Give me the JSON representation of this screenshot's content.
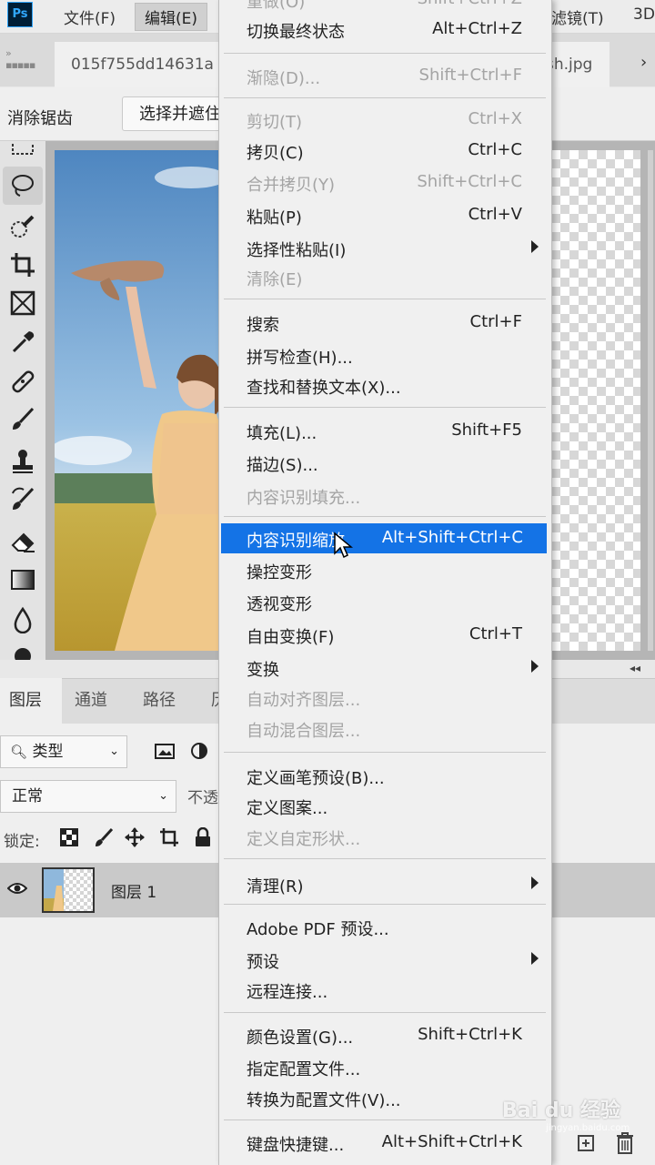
{
  "app": {
    "logo": "Ps"
  },
  "menubar": {
    "items": [
      {
        "label": "文件(F)"
      },
      {
        "label": "编辑(E)"
      },
      {
        "label": "滤镜(T)"
      },
      {
        "label": "3D"
      }
    ]
  },
  "tabs": [
    {
      "label": "015f755dd14631a"
    },
    {
      "label": "sh.jpg"
    }
  ],
  "options": {
    "antialias": "消除锯齿",
    "select_mask": "选择并遮住"
  },
  "edit_menu": {
    "items": [
      {
        "label": "重做(O)",
        "shortcut": "Shift+Ctrl+Z",
        "disabled": true
      },
      {
        "label": "切换最终状态",
        "shortcut": "Alt+Ctrl+Z"
      },
      {
        "label": "渐隐(D)...",
        "shortcut": "Shift+Ctrl+F",
        "disabled": true
      },
      {
        "label": "剪切(T)",
        "shortcut": "Ctrl+X",
        "disabled": true
      },
      {
        "label": "拷贝(C)",
        "shortcut": "Ctrl+C"
      },
      {
        "label": "合并拷贝(Y)",
        "shortcut": "Shift+Ctrl+C",
        "disabled": true
      },
      {
        "label": "粘贴(P)",
        "shortcut": "Ctrl+V"
      },
      {
        "label": "选择性粘贴(I)",
        "shortcut": "",
        "submenu": true
      },
      {
        "label": "清除(E)",
        "shortcut": "",
        "disabled": true
      },
      {
        "label": "搜索",
        "shortcut": "Ctrl+F"
      },
      {
        "label": "拼写检查(H)...",
        "shortcut": ""
      },
      {
        "label": "查找和替换文本(X)...",
        "shortcut": ""
      },
      {
        "label": "填充(L)...",
        "shortcut": "Shift+F5"
      },
      {
        "label": "描边(S)...",
        "shortcut": ""
      },
      {
        "label": "内容识别填充...",
        "shortcut": "",
        "disabled": true
      },
      {
        "label": "内容识别缩放",
        "shortcut": "Alt+Shift+Ctrl+C",
        "highlighted": true
      },
      {
        "label": "操控变形",
        "shortcut": ""
      },
      {
        "label": "透视变形",
        "shortcut": ""
      },
      {
        "label": "自由变换(F)",
        "shortcut": "Ctrl+T"
      },
      {
        "label": "变换",
        "shortcut": "",
        "submenu": true
      },
      {
        "label": "自动对齐图层...",
        "shortcut": "",
        "disabled": true
      },
      {
        "label": "自动混合图层...",
        "shortcut": "",
        "disabled": true
      },
      {
        "label": "定义画笔预设(B)...",
        "shortcut": ""
      },
      {
        "label": "定义图案...",
        "shortcut": ""
      },
      {
        "label": "定义自定形状...",
        "shortcut": "",
        "disabled": true
      },
      {
        "label": "清理(R)",
        "shortcut": "",
        "submenu": true
      },
      {
        "label": "Adobe PDF 预设...",
        "shortcut": ""
      },
      {
        "label": "预设",
        "shortcut": "",
        "submenu": true
      },
      {
        "label": "远程连接...",
        "shortcut": ""
      },
      {
        "label": "颜色设置(G)...",
        "shortcut": "Shift+Ctrl+K"
      },
      {
        "label": "指定配置文件...",
        "shortcut": ""
      },
      {
        "label": "转换为配置文件(V)...",
        "shortcut": ""
      },
      {
        "label": "键盘快捷键...",
        "shortcut": "Alt+Shift+Ctrl+K"
      }
    ]
  },
  "layers_panel": {
    "tabs": [
      "图层",
      "通道",
      "路径",
      "历"
    ],
    "filter": "类型",
    "blend_mode": "正常",
    "opacity_label": "不透",
    "lock_label": "锁定:",
    "layer_name": "图层 1"
  },
  "watermark": {
    "text": "Bai du 经验",
    "sub": "jingyan.baidu.com"
  },
  "colors": {
    "highlight": "#1473e6",
    "menu_bg": "#f0f0f0",
    "disabled": "#a4a4a4"
  }
}
